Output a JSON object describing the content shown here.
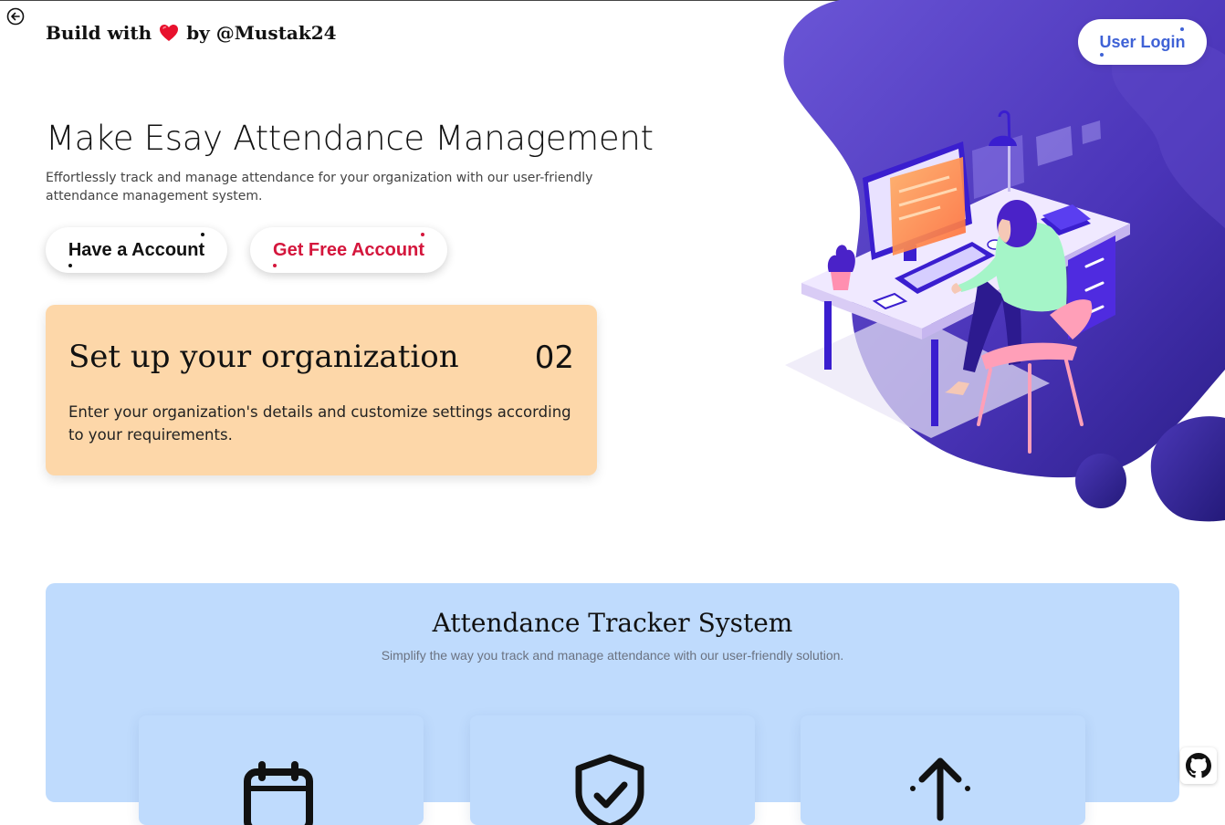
{
  "brand": {
    "prefix": "Build with",
    "suffix": "by @Mustak24"
  },
  "header": {
    "login_label": "User Login"
  },
  "hero": {
    "title": "Make Esay Attendance Management",
    "subtitle": "Effortlessly track and manage attendance for your organization with our user-friendly attendance management system.",
    "have_account_label": "Have a Account",
    "free_account_label": "Get Free Account"
  },
  "step": {
    "title": "Set up your organization",
    "number": "02",
    "description": "Enter your organization's details and customize settings according to your requirements."
  },
  "features": {
    "title": "Attendance Tracker System",
    "subtitle": "Simplify the way you track and manage attendance with our user-friendly solution.",
    "cards": [
      {
        "icon": "calendar-icon"
      },
      {
        "icon": "shield-check-icon"
      },
      {
        "icon": "upload-icon"
      }
    ]
  },
  "colors": {
    "accent_red": "#d4163c",
    "login_blue": "#3f62d6",
    "step_card_bg": "#fdd7a9",
    "features_bg": "#bfdbfd",
    "blob_purple": "#5b3fc4"
  }
}
